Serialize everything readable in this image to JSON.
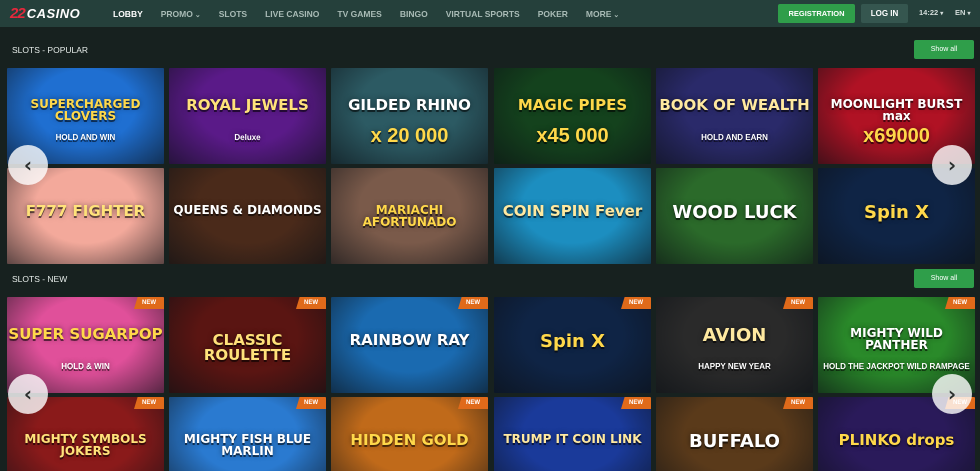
{
  "logo": {
    "mark": "22",
    "word": "CASINO"
  },
  "nav": [
    {
      "label": "LOBBY",
      "active": true,
      "dropdown": false
    },
    {
      "label": "PROMO",
      "active": false,
      "dropdown": true
    },
    {
      "label": "SLOTS",
      "active": false,
      "dropdown": false
    },
    {
      "label": "LIVE CASINO",
      "active": false,
      "dropdown": false
    },
    {
      "label": "TV GAMES",
      "active": false,
      "dropdown": false
    },
    {
      "label": "BINGO",
      "active": false,
      "dropdown": false
    },
    {
      "label": "VIRTUAL SPORTS",
      "active": false,
      "dropdown": false
    },
    {
      "label": "POKER",
      "active": false,
      "dropdown": false
    },
    {
      "label": "MORE",
      "active": false,
      "dropdown": true
    }
  ],
  "header": {
    "registration_label": "REGISTRATION",
    "login_label": "LOG IN",
    "time": "14:22",
    "language": "EN"
  },
  "sections": {
    "popular": {
      "title": "SLOTS - POPULAR",
      "show_all_label": "Show all",
      "games": [
        {
          "title": "SUPERCHARGED CLOVERS",
          "subtitle": "HOLD AND WIN",
          "bg": "#1f6fd1"
        },
        {
          "title": "ROYAL JEWELS",
          "subtitle": "Deluxe",
          "bg": "#5a1a88"
        },
        {
          "title": "GILDED RHINO",
          "subtitle": "x 20 000",
          "bg": "#2c5a63"
        },
        {
          "title": "MAGIC PIPES",
          "subtitle": "x45 000",
          "bg": "#14421d"
        },
        {
          "title": "BOOK OF WEALTH",
          "subtitle": "HOLD AND EARN",
          "bg": "#2a2a6a"
        },
        {
          "title": "MOONLIGHT BURST max",
          "subtitle": "x69000",
          "bg": "#b01224"
        },
        {
          "title": "F777 FIGHTER",
          "subtitle": "",
          "bg": "#f3a99b"
        },
        {
          "title": "QUEENS & DIAMONDS",
          "subtitle": "",
          "bg": "#4a2a1a"
        },
        {
          "title": "MARIACHI AFORTUNADO",
          "subtitle": "",
          "bg": "#7a5a4a"
        },
        {
          "title": "COIN SPIN Fever",
          "subtitle": "",
          "bg": "#1c8ec0"
        },
        {
          "title": "WOOD LUCK",
          "subtitle": "",
          "bg": "#2b6a2a"
        },
        {
          "title": "Spin X",
          "subtitle": "",
          "bg": "#0f2445"
        }
      ]
    },
    "new": {
      "title": "SLOTS - NEW",
      "show_all_label": "Show all",
      "games": [
        {
          "title": "SUPER SUGARPOP",
          "subtitle": "HOLD & WIN",
          "bg": "#e0509a",
          "badge": "NEW"
        },
        {
          "title": "CLASSIC ROULETTE",
          "subtitle": "",
          "bg": "#5a1512",
          "badge": "NEW"
        },
        {
          "title": "RAINBOW RAY",
          "subtitle": "",
          "bg": "#1a6ab0",
          "badge": "NEW"
        },
        {
          "title": "Spin X",
          "subtitle": "",
          "bg": "#0f2445",
          "badge": "NEW"
        },
        {
          "title": "AVION",
          "subtitle": "HAPPY NEW YEAR",
          "bg": "#2a2a2a",
          "badge": "NEW"
        },
        {
          "title": "MIGHTY WILD PANTHER",
          "subtitle": "HOLD THE JACKPOT WILD RAMPAGE",
          "bg": "#2a8a2a",
          "badge": "NEW"
        },
        {
          "title": "MIGHTY SYMBOLS JOKERS",
          "subtitle": "",
          "bg": "#8a1a1a",
          "badge": "NEW"
        },
        {
          "title": "MIGHTY FISH BLUE MARLIN",
          "subtitle": "",
          "bg": "#2a7ad0",
          "badge": "NEW"
        },
        {
          "title": "HIDDEN GOLD",
          "subtitle": "",
          "bg": "#c06a1a",
          "badge": "NEW"
        },
        {
          "title": "TRUMP IT COIN LINK",
          "subtitle": "",
          "bg": "#1a3a9a",
          "badge": "NEW"
        },
        {
          "title": "BUFFALO",
          "subtitle": "",
          "bg": "#5a3a1a",
          "badge": "NEW"
        },
        {
          "title": "PLINKO drops",
          "subtitle": "",
          "bg": "#2a1a5a",
          "badge": "NEW"
        }
      ]
    }
  },
  "icons": {
    "prev": "chevron-left-icon",
    "next": "chevron-right-icon"
  },
  "colors": {
    "accent": "#2f9e4a",
    "topbar": "#25403b",
    "background": "#17211f",
    "badge": "#e06a1a"
  }
}
